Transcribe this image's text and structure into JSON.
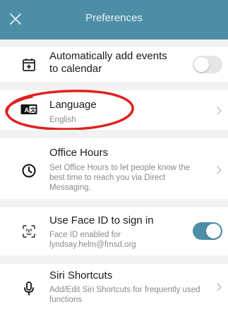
{
  "header": {
    "title": "Preferences"
  },
  "rows": {
    "calendar": {
      "title": "Automatically add events to calendar",
      "toggle_on": false
    },
    "language": {
      "title": "Language",
      "value": "English"
    },
    "office_hours": {
      "title": "Office Hours",
      "description": "Set Office Hours to let people know the best time to reach you via Direct Messaging."
    },
    "face_id": {
      "title": "Use Face ID to sign in",
      "description": "Face ID enabled for lyndsay.helm@fmsd.org",
      "toggle_on": true
    },
    "siri": {
      "title": "Siri Shortcuts",
      "description": "Add/Edit Siri Shortcuts for frequently used functions"
    }
  },
  "colors": {
    "accent": "#4d8ea6",
    "annotation": "#e0201f"
  },
  "icons": {
    "close": "close-icon",
    "calendar": "calendar-add-icon",
    "language": "language-icon",
    "clock": "clock-icon",
    "face_id": "face-id-icon",
    "microphone": "microphone-icon",
    "chevron": "chevron-right-icon"
  }
}
